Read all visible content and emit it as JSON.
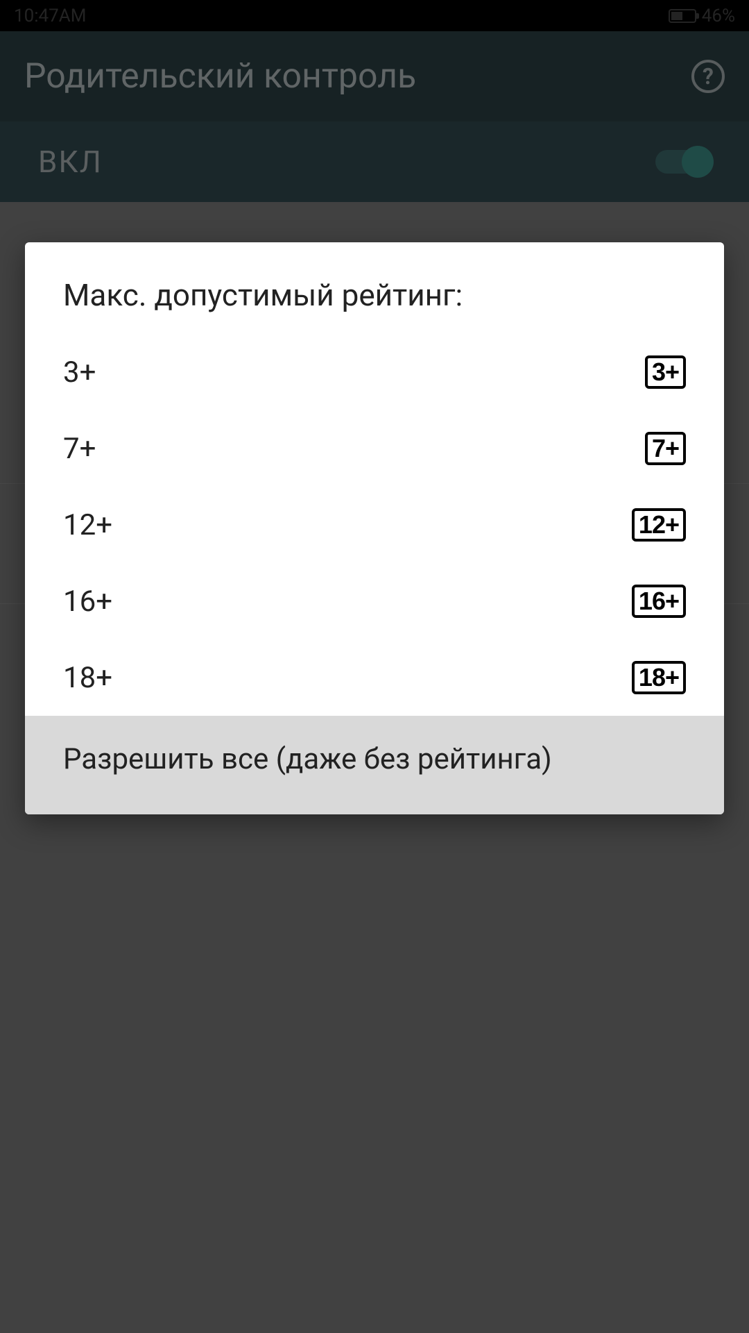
{
  "status": {
    "time": "10:47AM",
    "battery": "46%"
  },
  "header": {
    "title": "Родительский контроль"
  },
  "toggle": {
    "label": "ВКЛ"
  },
  "dialog": {
    "title": "Макс. допустимый рейтинг:",
    "options": [
      {
        "label": "3+",
        "badge": "3+"
      },
      {
        "label": "7+",
        "badge": "7+"
      },
      {
        "label": "12+",
        "badge": "12+"
      },
      {
        "label": "16+",
        "badge": "16+"
      },
      {
        "label": "18+",
        "badge": "18+"
      }
    ],
    "allow_all": "Разрешить все (даже без рейтинга)"
  }
}
